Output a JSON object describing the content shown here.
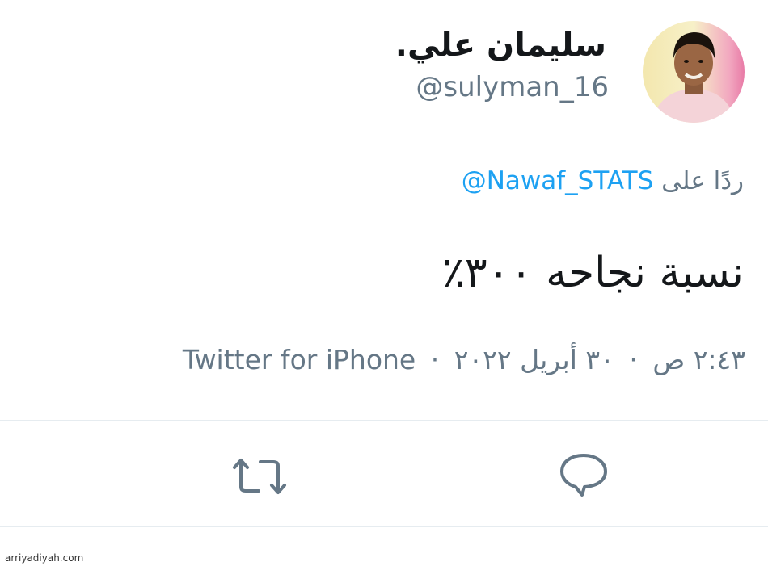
{
  "user": {
    "display_name": "سليمان علي.",
    "handle": "@sulyman_16"
  },
  "reply": {
    "prefix": "ردًا على",
    "mention": "@Nawaf_STATS"
  },
  "tweet": {
    "text": "نسبة نجاحه ٣٠٠٪"
  },
  "meta": {
    "time": "٢:٤٣ ص",
    "separator": "·",
    "date": "٣٠ أبريل ٢٠٢٢",
    "source": "Twitter for iPhone"
  },
  "actions": {
    "reply_icon": "reply-icon",
    "retweet_icon": "retweet-icon"
  },
  "watermark": "arriyadiyah.com",
  "colors": {
    "link": "#1da1f2",
    "secondary_text": "#657786",
    "primary_text": "#14171a",
    "divider": "#e6ecf0"
  }
}
